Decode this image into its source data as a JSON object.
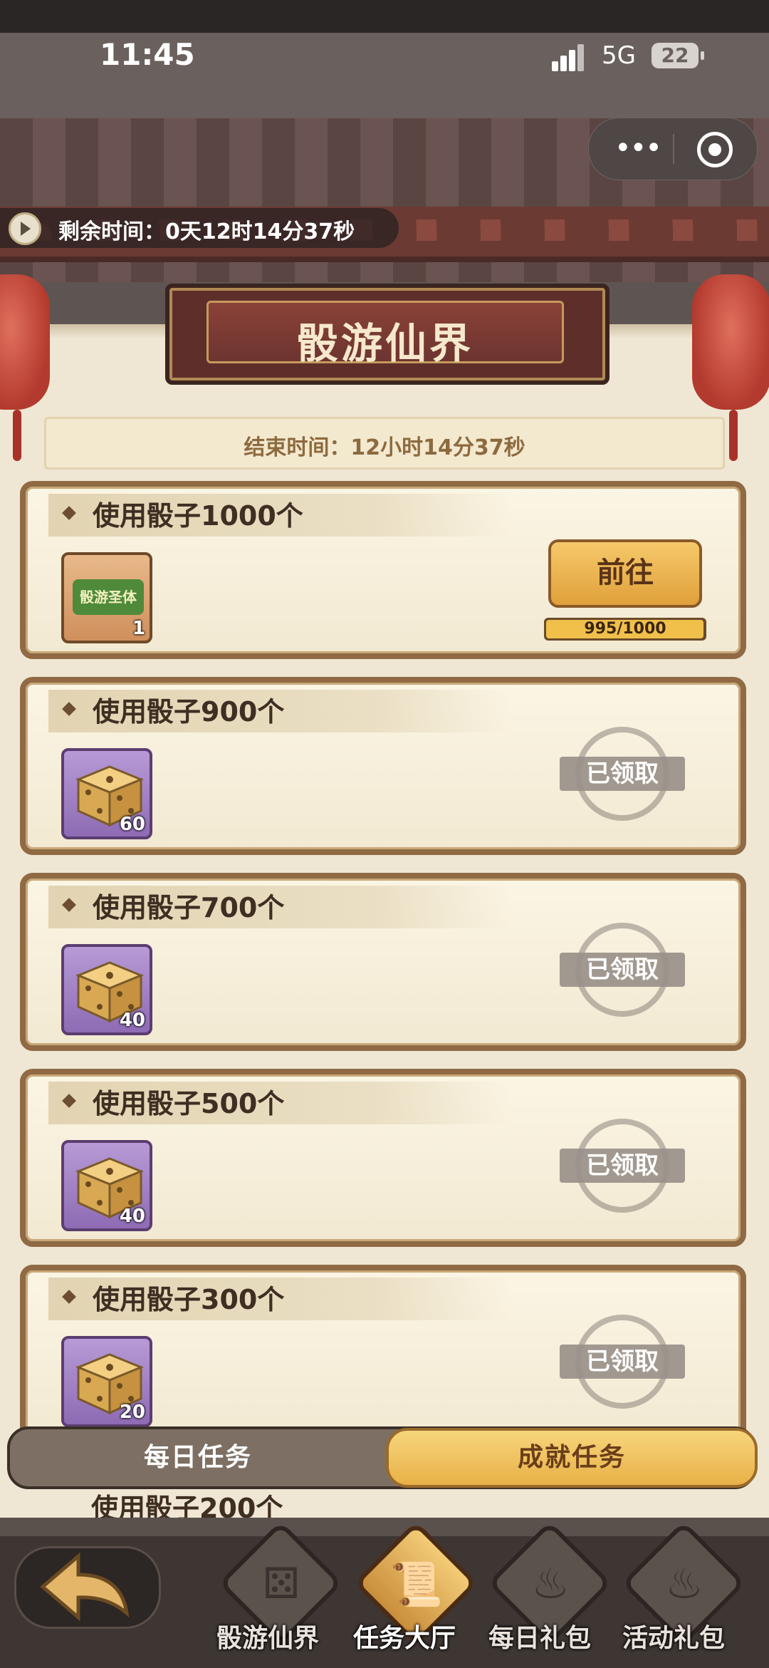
{
  "status": {
    "time": "11:45",
    "network": "5G",
    "battery": "22"
  },
  "header": {
    "timer_text": "剩余时间：0天12时14分37秒",
    "title": "骰游仙界",
    "end_time": "结束时间：12小时14分37秒"
  },
  "tasks": [
    {
      "name": "使用骰子1000个",
      "reward_qty": "1",
      "action_label": "前往",
      "progress_text": "995/1000",
      "progress": 0.995
    },
    {
      "name": "使用骰子900个",
      "reward_qty": "60",
      "status": "已领取"
    },
    {
      "name": "使用骰子700个",
      "reward_qty": "40",
      "status": "已领取"
    },
    {
      "name": "使用骰子500个",
      "reward_qty": "40",
      "status": "已领取"
    },
    {
      "name": "使用骰子300个",
      "reward_qty": "20",
      "status": "已领取"
    },
    {
      "name": "使用骰子200个"
    }
  ],
  "reward_item_label": "骰游圣体",
  "tabs": {
    "daily": "每日任务",
    "achievement": "成就任务"
  },
  "nav": {
    "items": [
      "骰游仙界",
      "任务大厅",
      "每日礼包",
      "活动礼包"
    ],
    "active": "任务大厅"
  },
  "colors": {
    "accent": "#e8b147",
    "card_border": "#8f6a44",
    "panel": "#efe7d4"
  }
}
